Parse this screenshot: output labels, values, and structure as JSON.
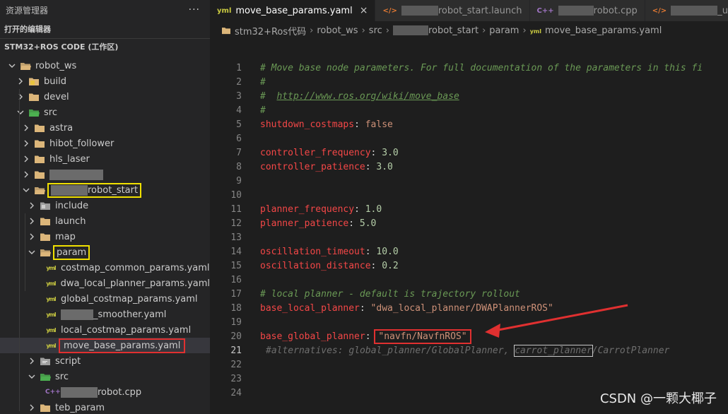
{
  "sidebar": {
    "title": "资源管理器",
    "more": "···",
    "open_editors": "打开的编辑器",
    "workspace": "STM32+ROS CODE (工作区)",
    "tree": [
      {
        "label": "robot_ws",
        "depth": 0,
        "expanded": true,
        "kind": "folder"
      },
      {
        "label": "build",
        "depth": 1,
        "expanded": false,
        "kind": "folder-special"
      },
      {
        "label": "devel",
        "depth": 1,
        "expanded": false,
        "kind": "folder"
      },
      {
        "label": "src",
        "depth": 1,
        "expanded": true,
        "kind": "folder-src"
      },
      {
        "label": "astra",
        "depth": 2,
        "expanded": false,
        "kind": "folder"
      },
      {
        "label": "hibot_follower",
        "depth": 2,
        "expanded": false,
        "kind": "folder"
      },
      {
        "label": "hls_laser",
        "depth": 2,
        "expanded": false,
        "kind": "folder"
      },
      {
        "label": "",
        "depth": 2,
        "expanded": false,
        "kind": "folder",
        "redact": 76
      },
      {
        "label": "robot_start",
        "depth": 2,
        "expanded": true,
        "kind": "folder",
        "redactPrefix": 52,
        "highlight": "yellow"
      },
      {
        "label": "include",
        "depth": 3,
        "expanded": false,
        "kind": "folder-include"
      },
      {
        "label": "launch",
        "depth": 3,
        "expanded": false,
        "kind": "folder"
      },
      {
        "label": "map",
        "depth": 3,
        "expanded": false,
        "kind": "folder"
      },
      {
        "label": "param",
        "depth": 3,
        "expanded": true,
        "kind": "folder",
        "highlight": "yellow"
      },
      {
        "label": "costmap_common_params.yaml",
        "depth": 4,
        "kind": "yaml"
      },
      {
        "label": "dwa_local_planner_params.yaml",
        "depth": 4,
        "kind": "yaml"
      },
      {
        "label": "global_costmap_params.yaml",
        "depth": 4,
        "kind": "yaml"
      },
      {
        "label": "_smoother.yaml",
        "depth": 4,
        "kind": "yaml",
        "redactPrefix": 46
      },
      {
        "label": "local_costmap_params.yaml",
        "depth": 4,
        "kind": "yaml"
      },
      {
        "label": "move_base_params.yaml",
        "depth": 4,
        "kind": "yaml",
        "highlight": "red",
        "selected": true
      },
      {
        "label": "script",
        "depth": 3,
        "expanded": false,
        "kind": "folder-script"
      },
      {
        "label": "src",
        "depth": 3,
        "expanded": true,
        "kind": "folder-src"
      },
      {
        "label": "robot.cpp",
        "depth": 4,
        "kind": "cpp",
        "redactPrefix": 52
      },
      {
        "label": "teb_param",
        "depth": 3,
        "expanded": false,
        "kind": "folder"
      }
    ]
  },
  "tabs": [
    {
      "label": "move_base_params.yaml",
      "icon": "yaml",
      "active": true,
      "close": "×"
    },
    {
      "label": "robot_start.launch",
      "icon": "xml",
      "redactPrefix": 52
    },
    {
      "label": "robot.cpp",
      "icon": "cpp",
      "redactPrefix": 50
    },
    {
      "label": "_urdf.launch",
      "icon": "xml",
      "redactPrefix": 66
    }
  ],
  "breadcrumb": [
    {
      "label": "stm32+Ros代码"
    },
    {
      "label": "robot_ws"
    },
    {
      "label": "src"
    },
    {
      "label": "robot_start",
      "redactPrefix": 50
    },
    {
      "label": "param"
    },
    {
      "label": "move_base_params.yaml"
    }
  ],
  "code": [
    {
      "n": "1",
      "t": "comment",
      "text": "# Move base node parameters. For full documentation of the parameters in this fi"
    },
    {
      "n": "2",
      "t": "comment",
      "text": "#"
    },
    {
      "n": "3",
      "t": "link",
      "prefix": "#  ",
      "text": "http://www.ros.org/wiki/move_base"
    },
    {
      "n": "4",
      "t": "comment",
      "text": "#"
    },
    {
      "n": "5",
      "t": "kv",
      "key": "shutdown_costmaps",
      "value": "false",
      "vt": "bool"
    },
    {
      "n": "6",
      "t": "blank"
    },
    {
      "n": "7",
      "t": "kv",
      "key": "controller_frequency",
      "value": "3.0",
      "vt": "num"
    },
    {
      "n": "8",
      "t": "kv",
      "key": "controller_patience",
      "value": "3.0",
      "vt": "num"
    },
    {
      "n": "9",
      "t": "blank"
    },
    {
      "n": "10",
      "t": "blank"
    },
    {
      "n": "11",
      "t": "kv",
      "key": "planner_frequency",
      "value": "1.0",
      "vt": "num"
    },
    {
      "n": "12",
      "t": "kv",
      "key": "planner_patience",
      "value": "5.0",
      "vt": "num"
    },
    {
      "n": "13",
      "t": "blank"
    },
    {
      "n": "14",
      "t": "kv",
      "key": "oscillation_timeout",
      "value": "10.0",
      "vt": "num"
    },
    {
      "n": "15",
      "t": "kv",
      "key": "oscillation_distance",
      "value": "0.2",
      "vt": "num"
    },
    {
      "n": "16",
      "t": "blank"
    },
    {
      "n": "17",
      "t": "comment",
      "text": "# local planner - default is trajectory rollout"
    },
    {
      "n": "18",
      "t": "kv",
      "key": "base_local_planner",
      "value": "\"dwa_local_planner/DWAPlannerROS\"",
      "vt": "str"
    },
    {
      "n": "19",
      "t": "blank"
    },
    {
      "n": "20",
      "t": "kv",
      "key": "base_global_planner",
      "value": "\"navfn/NavfnROS\"",
      "vt": "str",
      "boxed": true
    },
    {
      "n": "21",
      "t": "hint",
      "current": true,
      "a": "#alternatives: global_planner/GlobalPlanner, ",
      "b": "carrot_planner",
      "c": "/CarrotPlanner"
    },
    {
      "n": "22",
      "t": "blank"
    },
    {
      "n": "23",
      "t": "blank"
    },
    {
      "n": "24",
      "t": "blank"
    }
  ],
  "watermark": "CSDN @一颗大椰子",
  "colors": {
    "arrow": "#e03030",
    "highlight_yellow": "#f0e000",
    "highlight_red": "#e03030"
  }
}
